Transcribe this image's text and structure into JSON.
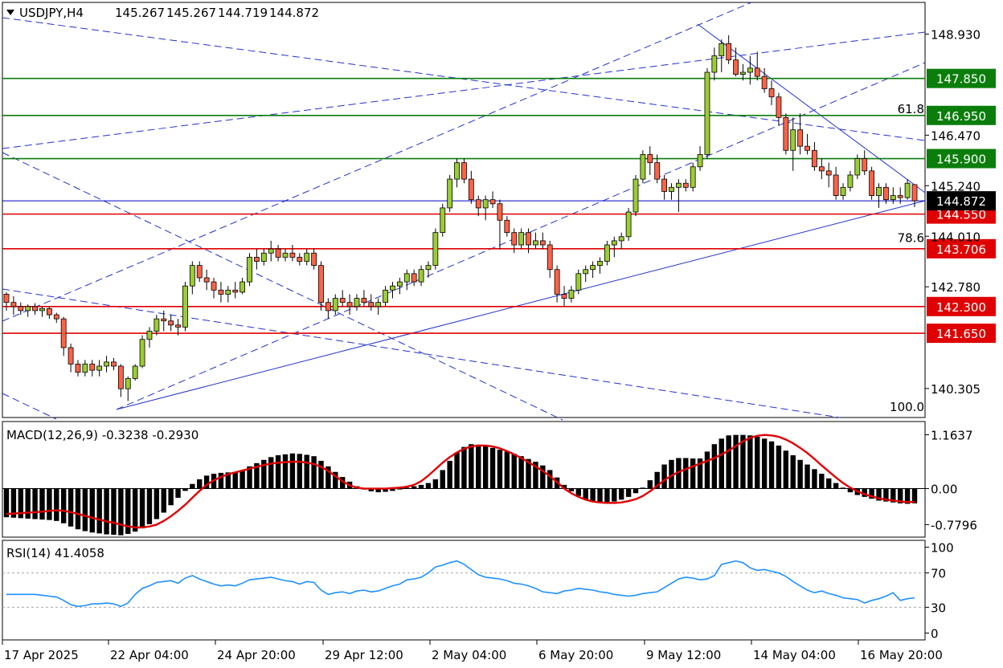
{
  "chart_data": {
    "type": "candlestick",
    "symbol": "USDJPY,H4",
    "header": {
      "symbol_label": "USDJPY,H4",
      "ohlc": [
        "145.267",
        "145.267",
        "144.719",
        "144.872"
      ]
    },
    "price_axis": {
      "ticks": [
        "148.930",
        "146.470",
        "145.240",
        "144.010",
        "142.780",
        "140.305"
      ],
      "ylim": [
        139.6,
        149.7
      ]
    },
    "current_price": "144.872",
    "levels": [
      {
        "value": 147.85,
        "label": "147.850",
        "color": "#0b7d0b"
      },
      {
        "value": 146.95,
        "label": "146.950",
        "color": "#0b7d0b"
      },
      {
        "value": 145.9,
        "label": "145.900",
        "color": "#0b7d0b"
      },
      {
        "value": 144.55,
        "label": "144.550",
        "color": "#e00000"
      },
      {
        "value": 143.706,
        "label": "143.706",
        "color": "#e00000"
      },
      {
        "value": 142.3,
        "label": "142.300",
        "color": "#e00000"
      },
      {
        "value": 141.65,
        "label": "141.650",
        "color": "#e00000"
      }
    ],
    "fib_labels": [
      {
        "label": "61.8",
        "value": 147.1
      },
      {
        "label": "78.6",
        "value": 143.97
      },
      {
        "label": "100.0",
        "value": 139.85
      }
    ],
    "candles": [
      [
        142.6,
        142.65,
        142.2,
        142.4
      ],
      [
        142.4,
        142.55,
        142.1,
        142.3
      ],
      [
        142.3,
        142.4,
        142.1,
        142.2
      ],
      [
        142.2,
        142.35,
        142.05,
        142.3
      ],
      [
        142.3,
        142.38,
        142.1,
        142.2
      ],
      [
        142.2,
        142.3,
        142.05,
        142.25
      ],
      [
        142.25,
        142.3,
        142.0,
        142.1
      ],
      [
        142.1,
        142.15,
        141.9,
        142.0
      ],
      [
        142.0,
        142.05,
        141.1,
        141.3
      ],
      [
        141.3,
        141.4,
        140.7,
        140.9
      ],
      [
        140.9,
        141.0,
        140.6,
        140.7
      ],
      [
        140.7,
        141.0,
        140.6,
        140.9
      ],
      [
        140.9,
        141.0,
        140.6,
        140.75
      ],
      [
        140.75,
        141.0,
        140.6,
        140.85
      ],
      [
        140.85,
        141.1,
        140.7,
        140.95
      ],
      [
        140.95,
        141.05,
        140.75,
        140.85
      ],
      [
        140.85,
        140.9,
        140.1,
        140.3
      ],
      [
        140.3,
        140.6,
        140.0,
        140.55
      ],
      [
        140.55,
        140.9,
        140.5,
        140.85
      ],
      [
        140.85,
        141.6,
        140.8,
        141.5
      ],
      [
        141.5,
        141.8,
        141.3,
        141.7
      ],
      [
        141.7,
        142.1,
        141.6,
        142.0
      ],
      [
        142.0,
        142.2,
        141.7,
        141.95
      ],
      [
        141.95,
        142.1,
        141.7,
        141.85
      ],
      [
        141.85,
        142.0,
        141.6,
        141.8
      ],
      [
        141.8,
        142.9,
        141.7,
        142.8
      ],
      [
        142.8,
        143.4,
        142.6,
        143.3
      ],
      [
        143.3,
        143.4,
        142.9,
        143.0
      ],
      [
        143.0,
        143.2,
        142.7,
        142.9
      ],
      [
        142.9,
        143.0,
        142.5,
        142.7
      ],
      [
        142.7,
        142.9,
        142.4,
        142.6
      ],
      [
        142.6,
        142.8,
        142.4,
        142.7
      ],
      [
        142.7,
        142.9,
        142.5,
        142.65
      ],
      [
        142.65,
        143.0,
        142.6,
        142.9
      ],
      [
        142.9,
        143.6,
        142.8,
        143.5
      ],
      [
        143.5,
        143.7,
        143.2,
        143.4
      ],
      [
        143.4,
        143.7,
        143.3,
        143.6
      ],
      [
        143.6,
        143.9,
        143.4,
        143.7
      ],
      [
        143.7,
        143.8,
        143.4,
        143.5
      ],
      [
        143.5,
        143.7,
        143.4,
        143.6
      ],
      [
        143.6,
        143.8,
        143.4,
        143.5
      ],
      [
        143.5,
        143.6,
        143.3,
        143.4
      ],
      [
        143.4,
        143.7,
        143.3,
        143.6
      ],
      [
        143.6,
        143.7,
        143.2,
        143.3
      ],
      [
        143.3,
        143.4,
        142.2,
        142.4
      ],
      [
        142.4,
        142.5,
        142.0,
        142.2
      ],
      [
        142.2,
        142.6,
        142.1,
        142.5
      ],
      [
        142.5,
        142.7,
        142.3,
        142.4
      ],
      [
        142.4,
        142.6,
        142.1,
        142.3
      ],
      [
        142.3,
        142.6,
        142.2,
        142.5
      ],
      [
        142.5,
        142.7,
        142.3,
        142.4
      ],
      [
        142.4,
        142.6,
        142.2,
        142.3
      ],
      [
        142.3,
        142.5,
        142.1,
        142.4
      ],
      [
        142.4,
        142.8,
        142.3,
        142.7
      ],
      [
        142.7,
        142.9,
        142.5,
        142.8
      ],
      [
        142.8,
        143.0,
        142.6,
        142.9
      ],
      [
        142.9,
        143.2,
        142.7,
        143.1
      ],
      [
        143.1,
        143.2,
        142.8,
        142.9
      ],
      [
        142.9,
        143.3,
        142.8,
        143.2
      ],
      [
        143.2,
        143.4,
        143.0,
        143.3
      ],
      [
        143.3,
        144.2,
        143.2,
        144.1
      ],
      [
        144.1,
        144.8,
        144.0,
        144.7
      ],
      [
        144.7,
        145.5,
        144.6,
        145.4
      ],
      [
        145.4,
        145.9,
        145.2,
        145.8
      ],
      [
        145.8,
        145.9,
        145.3,
        145.4
      ],
      [
        145.4,
        145.6,
        144.8,
        144.9
      ],
      [
        144.9,
        145.0,
        144.5,
        144.7
      ],
      [
        144.7,
        145.0,
        144.4,
        144.9
      ],
      [
        144.9,
        145.1,
        144.7,
        144.8
      ],
      [
        144.8,
        144.9,
        143.7,
        144.4
      ],
      [
        144.4,
        144.5,
        144.0,
        144.1
      ],
      [
        144.1,
        144.2,
        143.6,
        143.8
      ],
      [
        143.8,
        144.2,
        143.7,
        144.1
      ],
      [
        144.1,
        144.2,
        143.6,
        143.8
      ],
      [
        143.8,
        144.1,
        143.7,
        143.9
      ],
      [
        143.9,
        144.1,
        143.7,
        143.8
      ],
      [
        143.8,
        143.9,
        143.0,
        143.2
      ],
      [
        143.2,
        143.3,
        142.4,
        142.6
      ],
      [
        142.6,
        142.8,
        142.3,
        142.5
      ],
      [
        142.5,
        142.8,
        142.4,
        142.7
      ],
      [
        142.7,
        143.2,
        142.6,
        143.1
      ],
      [
        143.1,
        143.3,
        142.9,
        143.2
      ],
      [
        143.2,
        143.4,
        143.0,
        143.3
      ],
      [
        143.3,
        143.5,
        143.1,
        143.4
      ],
      [
        143.4,
        143.9,
        143.3,
        143.8
      ],
      [
        143.8,
        144.0,
        143.5,
        143.9
      ],
      [
        143.9,
        144.1,
        143.7,
        144.0
      ],
      [
        144.0,
        144.7,
        143.9,
        144.6
      ],
      [
        144.6,
        145.5,
        144.5,
        145.4
      ],
      [
        145.4,
        146.1,
        145.3,
        146.0
      ],
      [
        146.0,
        146.2,
        145.5,
        145.8
      ],
      [
        145.8,
        146.0,
        145.3,
        145.4
      ],
      [
        145.4,
        145.5,
        144.9,
        145.1
      ],
      [
        145.1,
        145.3,
        144.9,
        145.2
      ],
      [
        145.2,
        145.4,
        144.6,
        145.3
      ],
      [
        145.3,
        145.4,
        145.1,
        145.2
      ],
      [
        145.2,
        145.8,
        145.1,
        145.7
      ],
      [
        145.7,
        146.2,
        145.6,
        146.0
      ],
      [
        146.0,
        148.1,
        145.9,
        148.0
      ],
      [
        148.0,
        148.6,
        147.8,
        148.4
      ],
      [
        148.4,
        148.8,
        148.0,
        148.7
      ],
      [
        148.7,
        148.9,
        148.2,
        148.3
      ],
      [
        148.3,
        148.6,
        147.9,
        147.95
      ],
      [
        147.95,
        148.2,
        147.8,
        148.0
      ],
      [
        148.0,
        148.4,
        147.7,
        148.1
      ],
      [
        148.1,
        148.5,
        147.8,
        147.9
      ],
      [
        147.9,
        148.1,
        147.5,
        147.6
      ],
      [
        147.6,
        147.8,
        147.2,
        147.4
      ],
      [
        147.4,
        147.5,
        146.7,
        146.9
      ],
      [
        146.9,
        147.0,
        146.0,
        146.1
      ],
      [
        146.1,
        146.9,
        145.6,
        146.6
      ],
      [
        146.6,
        147.0,
        146.0,
        146.2
      ],
      [
        146.2,
        146.5,
        146.0,
        146.1
      ],
      [
        146.1,
        146.3,
        145.6,
        145.7
      ],
      [
        145.7,
        145.9,
        145.4,
        145.6
      ],
      [
        145.6,
        145.8,
        145.2,
        145.5
      ],
      [
        145.5,
        145.7,
        144.9,
        145.0
      ],
      [
        145.0,
        145.3,
        144.9,
        145.2
      ],
      [
        145.2,
        145.6,
        145.1,
        145.5
      ],
      [
        145.5,
        146.0,
        145.4,
        145.9
      ],
      [
        145.9,
        146.1,
        145.5,
        145.6
      ],
      [
        145.6,
        145.7,
        144.9,
        145.0
      ],
      [
        145.0,
        145.3,
        144.7,
        145.2
      ],
      [
        145.2,
        145.3,
        144.8,
        144.9
      ],
      [
        144.9,
        145.2,
        144.8,
        145.0
      ],
      [
        145.0,
        145.2,
        144.8,
        144.95
      ],
      [
        144.95,
        145.4,
        144.9,
        145.3
      ],
      [
        145.267,
        145.267,
        144.719,
        144.872
      ]
    ],
    "time_labels": [
      "17 Apr 2025",
      "22 Apr 04:00",
      "24 Apr 20:00",
      "29 Apr 12:00",
      "2 May 04:00",
      "6 May 20:00",
      "9 May 12:00",
      "14 May 04:00",
      "16 May 20:00"
    ],
    "macd": {
      "label": "MACD(12,26,9) -0.3238 -0.2930",
      "ticks": [
        "1.1637",
        "0.00",
        "-0.7796"
      ],
      "ylim": [
        -1.05,
        1.45
      ],
      "histogram": [
        -0.62,
        -0.63,
        -0.64,
        -0.65,
        -0.66,
        -0.67,
        -0.68,
        -0.7,
        -0.75,
        -0.82,
        -0.88,
        -0.92,
        -0.95,
        -0.97,
        -0.99,
        -1.0,
        -1.01,
        -0.98,
        -0.93,
        -0.86,
        -0.77,
        -0.66,
        -0.52,
        -0.36,
        -0.2,
        -0.05,
        0.1,
        0.2,
        0.28,
        0.32,
        0.34,
        0.35,
        0.36,
        0.4,
        0.48,
        0.55,
        0.62,
        0.68,
        0.72,
        0.74,
        0.76,
        0.75,
        0.73,
        0.7,
        0.6,
        0.48,
        0.36,
        0.25,
        0.15,
        0.05,
        -0.02,
        -0.06,
        -0.08,
        -0.07,
        -0.05,
        -0.02,
        0.02,
        0.05,
        0.08,
        0.12,
        0.2,
        0.4,
        0.6,
        0.78,
        0.9,
        0.96,
        0.95,
        0.92,
        0.88,
        0.84,
        0.8,
        0.75,
        0.7,
        0.64,
        0.58,
        0.5,
        0.4,
        0.24,
        0.08,
        -0.06,
        -0.16,
        -0.24,
        -0.28,
        -0.3,
        -0.3,
        -0.28,
        -0.24,
        -0.18,
        -0.1,
        0.02,
        0.18,
        0.36,
        0.52,
        0.62,
        0.66,
        0.66,
        0.65,
        0.65,
        0.8,
        0.96,
        1.08,
        1.15,
        1.16,
        1.16,
        1.15,
        1.12,
        1.08,
        1.02,
        0.93,
        0.82,
        0.72,
        0.62,
        0.52,
        0.42,
        0.32,
        0.22,
        0.12,
        0.02,
        -0.08,
        -0.14,
        -0.18,
        -0.22,
        -0.26,
        -0.28,
        -0.3,
        -0.32,
        -0.33,
        -0.32
      ],
      "signal": [
        -0.55,
        -0.54,
        -0.53,
        -0.52,
        -0.51,
        -0.5,
        -0.48,
        -0.47,
        -0.48,
        -0.51,
        -0.55,
        -0.59,
        -0.63,
        -0.67,
        -0.71,
        -0.74,
        -0.78,
        -0.82,
        -0.84,
        -0.84,
        -0.82,
        -0.78,
        -0.7,
        -0.6,
        -0.48,
        -0.35,
        -0.2,
        -0.05,
        0.08,
        0.18,
        0.25,
        0.31,
        0.35,
        0.39,
        0.43,
        0.47,
        0.51,
        0.54,
        0.56,
        0.57,
        0.58,
        0.58,
        0.56,
        0.53,
        0.47,
        0.38,
        0.27,
        0.16,
        0.07,
        0.02,
        0.0,
        0.0,
        0.0,
        0.0,
        0.01,
        0.02,
        0.04,
        0.08,
        0.16,
        0.28,
        0.42,
        0.56,
        0.68,
        0.78,
        0.86,
        0.91,
        0.93,
        0.93,
        0.91,
        0.87,
        0.81,
        0.74,
        0.66,
        0.57,
        0.48,
        0.38,
        0.27,
        0.14,
        0.0,
        -0.1,
        -0.18,
        -0.24,
        -0.28,
        -0.3,
        -0.31,
        -0.31,
        -0.3,
        -0.27,
        -0.23,
        -0.16,
        -0.06,
        0.06,
        0.18,
        0.28,
        0.36,
        0.42,
        0.48,
        0.54,
        0.6,
        0.66,
        0.74,
        0.82,
        0.92,
        1.02,
        1.1,
        1.14,
        1.16,
        1.15,
        1.12,
        1.06,
        0.98,
        0.88,
        0.77,
        0.64,
        0.5,
        0.37,
        0.24,
        0.12,
        0.02,
        -0.06,
        -0.12,
        -0.17,
        -0.21,
        -0.24,
        -0.26,
        -0.28,
        -0.29,
        -0.29
      ]
    },
    "rsi": {
      "label": "RSI(14) 41.4058",
      "ticks": [
        "100",
        "70",
        "30",
        "0"
      ],
      "ylim": [
        -8,
        108
      ],
      "levels": [
        70,
        30
      ],
      "values": [
        45,
        45,
        45,
        45,
        45,
        44,
        43,
        42,
        38,
        33,
        31,
        32,
        34,
        34,
        35,
        34,
        31,
        35,
        45,
        52,
        55,
        59,
        60,
        61,
        58,
        64,
        67,
        63,
        60,
        57,
        55,
        56,
        55,
        58,
        62,
        63,
        64,
        65,
        63,
        61,
        60,
        57,
        60,
        59,
        50,
        45,
        47,
        48,
        46,
        49,
        50,
        48,
        49,
        52,
        55,
        57,
        62,
        63,
        65,
        70,
        77,
        79,
        82,
        84,
        80,
        74,
        68,
        65,
        64,
        63,
        61,
        58,
        57,
        55,
        52,
        48,
        47,
        46,
        49,
        50,
        52,
        51,
        50,
        48,
        47,
        45,
        44,
        43,
        44,
        46,
        47,
        48,
        53,
        58,
        63,
        65,
        64,
        62,
        63,
        67,
        80,
        82,
        84,
        82,
        76,
        73,
        74,
        72,
        70,
        66,
        60,
        55,
        50,
        47,
        49,
        46,
        44,
        41,
        40,
        39,
        35,
        38,
        40,
        43,
        47,
        38,
        40,
        41
      ]
    },
    "colors": {
      "bull": "#9ACD32",
      "bear": "#FF6347",
      "price_line": "#0000cc",
      "trend": "#2233cc",
      "macd_signal": "#e00000",
      "rsi_line": "#1e90ff"
    }
  }
}
